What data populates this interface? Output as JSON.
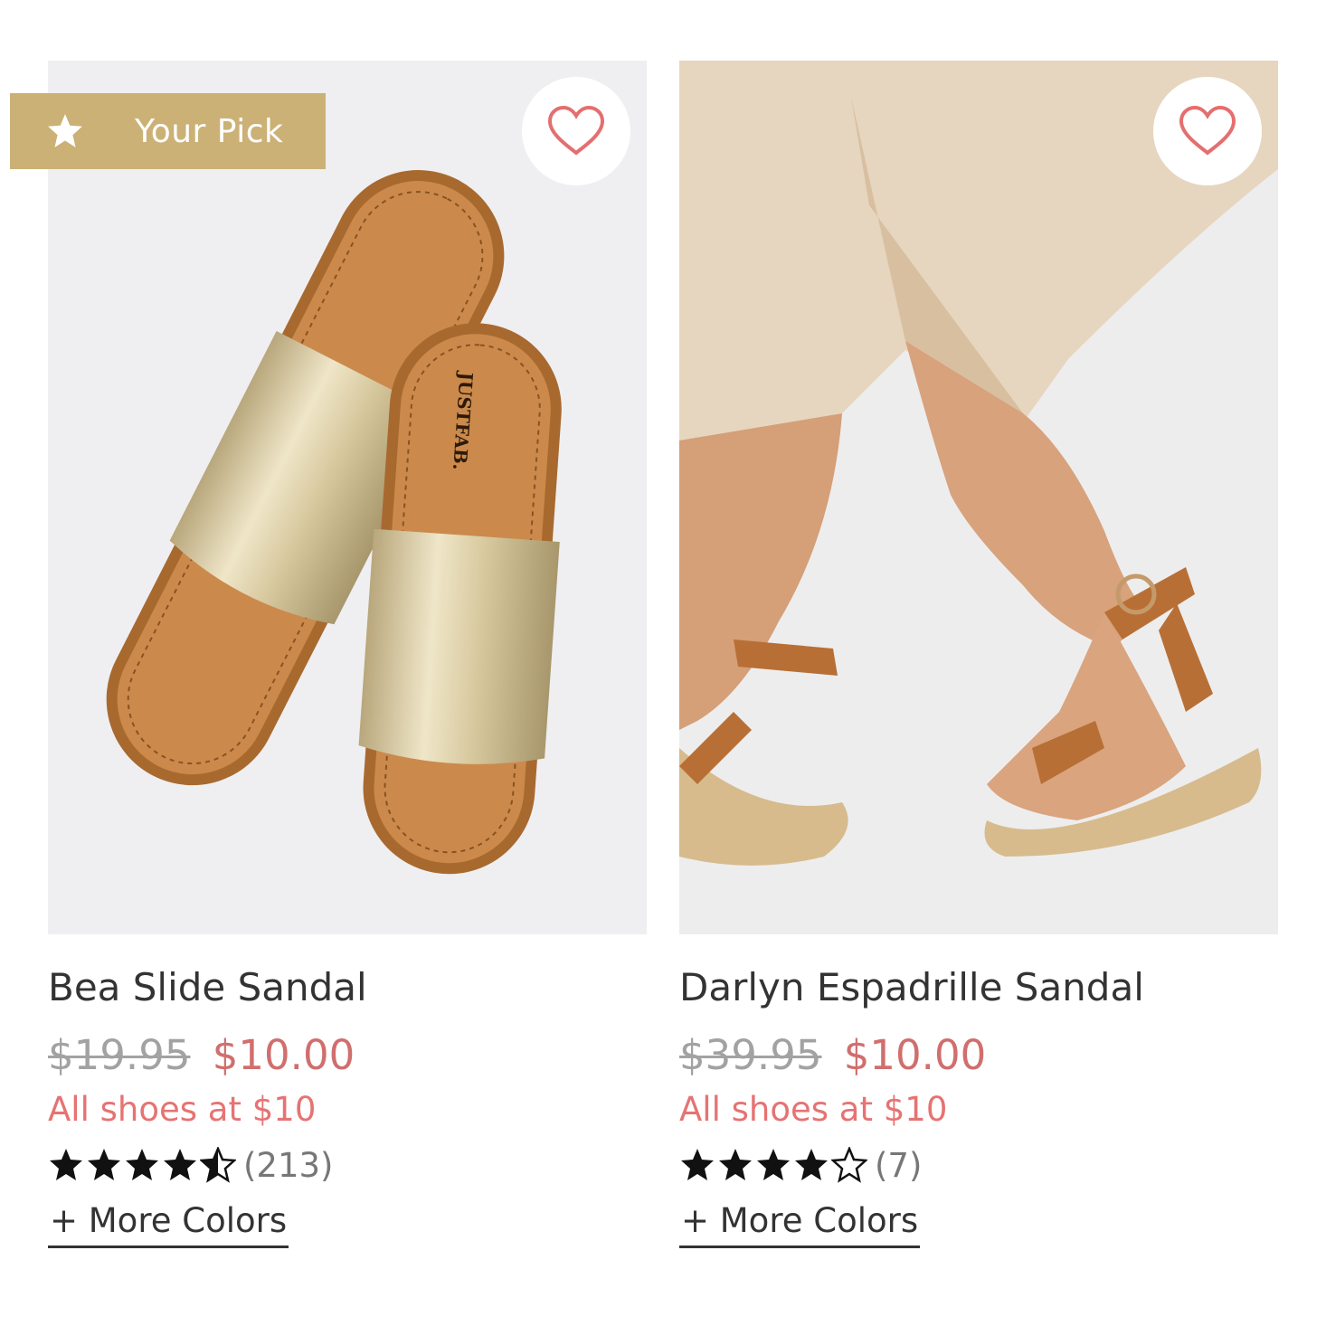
{
  "colors": {
    "badge": "#cbb176",
    "heart": "#e46f6f",
    "sale_price": "#d16e6e",
    "promo": "#e67373"
  },
  "products": [
    {
      "badge": {
        "icon": "star-icon",
        "label": "Your Pick"
      },
      "brand_mark": "JUSTFAB.",
      "name": "Bea Slide Sandal",
      "original_price": "$19.95",
      "sale_price": "$10.00",
      "promo": "All shoes at $10",
      "rating": 4.5,
      "review_count": "(213)",
      "more_colors": "+ More Colors"
    },
    {
      "name": "Darlyn Espadrille Sandal",
      "original_price": "$39.95",
      "sale_price": "$10.00",
      "promo": "All shoes at $10",
      "rating": 4,
      "review_count": "(7)",
      "more_colors": "+ More Colors"
    }
  ]
}
